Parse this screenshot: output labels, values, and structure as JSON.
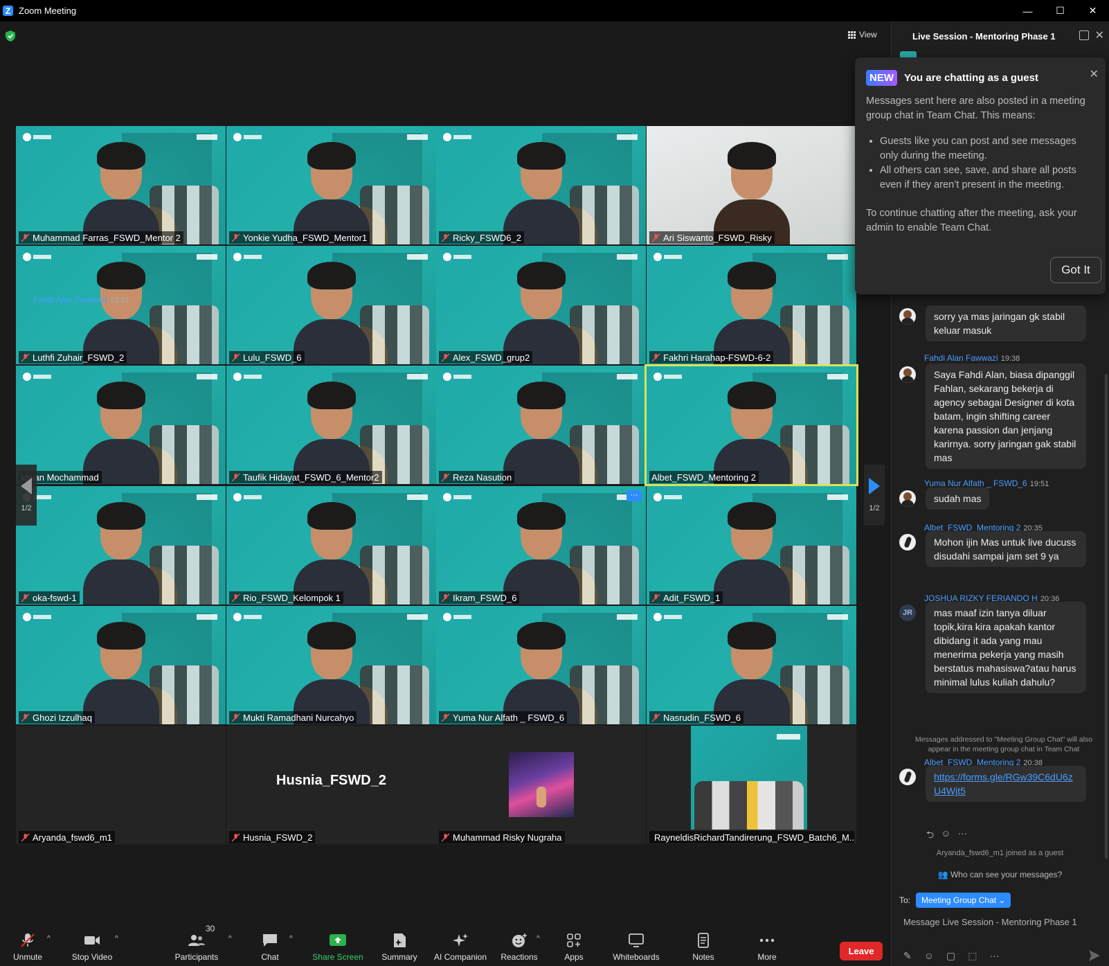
{
  "window": {
    "title": "Zoom Meeting",
    "controls": [
      "—",
      "☐",
      "✕"
    ]
  },
  "stage": {
    "view_label": "View",
    "pager_label": "1/2"
  },
  "tiles": [
    {
      "name": "Muhammad Farras_FSWD_Mentor 2",
      "style": "teal",
      "muted": true
    },
    {
      "name": "Yonkie Yudha_FSWD_Mentor1",
      "style": "teal",
      "muted": true
    },
    {
      "name": "Ricky_FSWD6_2",
      "style": "teal",
      "muted": true
    },
    {
      "name": "Ari Siswanto_FSWD_Risky",
      "style": "light",
      "muted": true
    },
    {
      "name": "Luthfi Zuhair_FSWD_2",
      "style": "teal",
      "muted": true
    },
    {
      "name": "Lulu_FSWD_6",
      "style": "teal",
      "muted": true
    },
    {
      "name": "Alex_FSWD_grup2",
      "style": "teal",
      "muted": true
    },
    {
      "name": "Fakhri Harahap-FSWD-6-2",
      "style": "teal",
      "muted": true
    },
    {
      "name": "idwan Mochammad",
      "style": "teal",
      "muted": false
    },
    {
      "name": "Taufik Hidayat_FSWD_6_Mentor2",
      "style": "teal",
      "muted": true
    },
    {
      "name": "Reza Nasution",
      "style": "teal",
      "muted": true
    },
    {
      "name": "Albet_FSWD_Mentoring 2",
      "style": "teal",
      "muted": false
    },
    {
      "name": "oka-fswd-1",
      "style": "teal",
      "muted": true
    },
    {
      "name": "Rio_FSWD_Kelompok 1",
      "style": "teal",
      "muted": true
    },
    {
      "name": "Ikram_FSWD_6",
      "style": "teal",
      "muted": true
    },
    {
      "name": "Adit_FSWD_1",
      "style": "teal",
      "muted": true
    },
    {
      "name": "Ghozi Izzulhaq",
      "style": "teal",
      "muted": true
    },
    {
      "name": "Mukti Ramadhani Nurcahyo",
      "style": "teal",
      "muted": true
    },
    {
      "name": "Yuma Nur Alfath _ FSWD_6",
      "style": "teal",
      "muted": true
    },
    {
      "name": "Nasrudin_FSWD_6",
      "style": "teal",
      "muted": true
    },
    {
      "name": "Aryanda_fswd6_m1",
      "style": "dark",
      "muted": true
    },
    {
      "name": "Husnia_FSWD_2",
      "style": "dark",
      "muted": true,
      "big_label": "Husnia_FSWD_2"
    },
    {
      "name": "Muhammad Risky Nugraha",
      "style": "dark",
      "muted": true
    },
    {
      "name": "RayneldisRichardTandirerung_FSWD_Batch6_M...",
      "style": "dark",
      "muted": true
    }
  ],
  "more_badge": "···",
  "toolbar": {
    "unmute": "Unmute",
    "stop_video": "Stop Video",
    "participants": "Participants",
    "participants_count": "30",
    "chat": "Chat",
    "share": "Share Screen",
    "summary": "Summary",
    "ai": "AI Companion",
    "reactions": "Reactions",
    "apps": "Apps",
    "whiteboards": "Whiteboards",
    "notes": "Notes",
    "more": "More",
    "leave": "Leave"
  },
  "panel": {
    "title": "Live Session - Mentoring Phase 1",
    "guest_popup": {
      "badge": "NEW",
      "title": "You are chatting as a guest",
      "intro": "Messages sent here are also posted in a meeting group chat in Team Chat. This means:",
      "bullets": [
        "Guests like you can post and see messages only during the meeting.",
        "All others can see, save, and share all posts even if they aren’t present in the meeting."
      ],
      "footer": "To continue chatting after the meeting, ask your admin to enable Team Chat.",
      "button": "Got It"
    },
    "messages": [
      {
        "sender": "Fahdi Alan Fawwazi",
        "time": "19:32",
        "text": "sorry ya mas jaringan gk stabil keluar masuk"
      },
      {
        "sender": "Fahdi Alan Fawwazi",
        "time": "19:38",
        "text": "Saya Fahdi Alan, biasa dipanggil Fahlan, sekarang bekerja di agency sebagai Designer di kota batam, ingin shifting career karena passion dan jenjang karirnya. sorry jaringan gak stabil mas"
      },
      {
        "sender": "Yuma Nur Alfath _ FSWD_6",
        "time": "19:51",
        "text": "sudah mas"
      },
      {
        "sender": "Albet_FSWD_Mentoring 2",
        "time": "20:35",
        "text": "Mohon ijin Mas untuk live ducuss disudahi sampai jam set 9 ya"
      },
      {
        "sender": "JOSHUA RIZKY FERIANDO H",
        "time": "20:36",
        "initials": "JR",
        "text": "mas maaf izin tanya diluar topik,kira kira apakah kantor dibidang it ada yang mau menerima pekerja yang masih berstatus mahasiswa?atau harus minimal lulus kuliah dahulu?"
      },
      {
        "sender": "Albet_FSWD_Mentoring 2",
        "time": "20:38",
        "link": "https://forms.gle/RGw39C6dU6zU4Wjt5"
      }
    ],
    "system_note": "Messages addressed to \"Meeting Group Chat\" will also appear in the meeting group chat in Team Chat",
    "joined_note": "Aryanda_fswd6_m1 joined as a guest",
    "who_can_see": "Who can see your messages?",
    "to_label": "To:",
    "recipient": "Meeting Group Chat ⌄",
    "input_placeholder": "Message Live Session - Mentoring Phase 1"
  }
}
